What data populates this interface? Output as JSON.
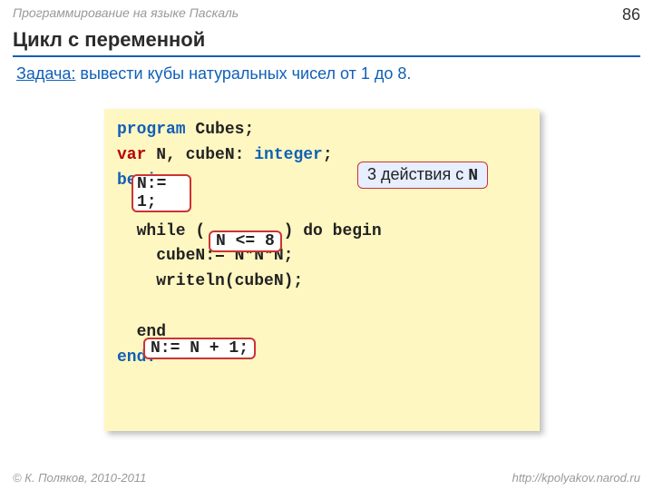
{
  "header": {
    "course": "Программирование на языке Паскаль",
    "page": "86"
  },
  "title": "Цикл с переменной",
  "task": {
    "label": "Задача:",
    "text": " вывести кубы натуральных чисел от 1 до 8."
  },
  "code": {
    "l1a": "program",
    "l1b": " Cubes;",
    "l2a": "var",
    "l2b": " N, cubeN: ",
    "l2c": "integer",
    "l2d": ";",
    "l3": "begin",
    "init1": "N:=",
    "init2": "1;",
    "l5a": "  while ( ",
    "cond": "N <= 8",
    "l5b": " ) do begin",
    "l6": "    cubeN:= N*N*N;",
    "l7": "    writeln(cubeN);",
    "incr": "N:= N + 1;",
    "l9": "  end",
    "l10": "end."
  },
  "callout": {
    "a": "3 действия с ",
    "b": "N"
  },
  "footer": {
    "left": "© К. Поляков, 2010-2011",
    "right": "http://kpolyakov.narod.ru"
  }
}
